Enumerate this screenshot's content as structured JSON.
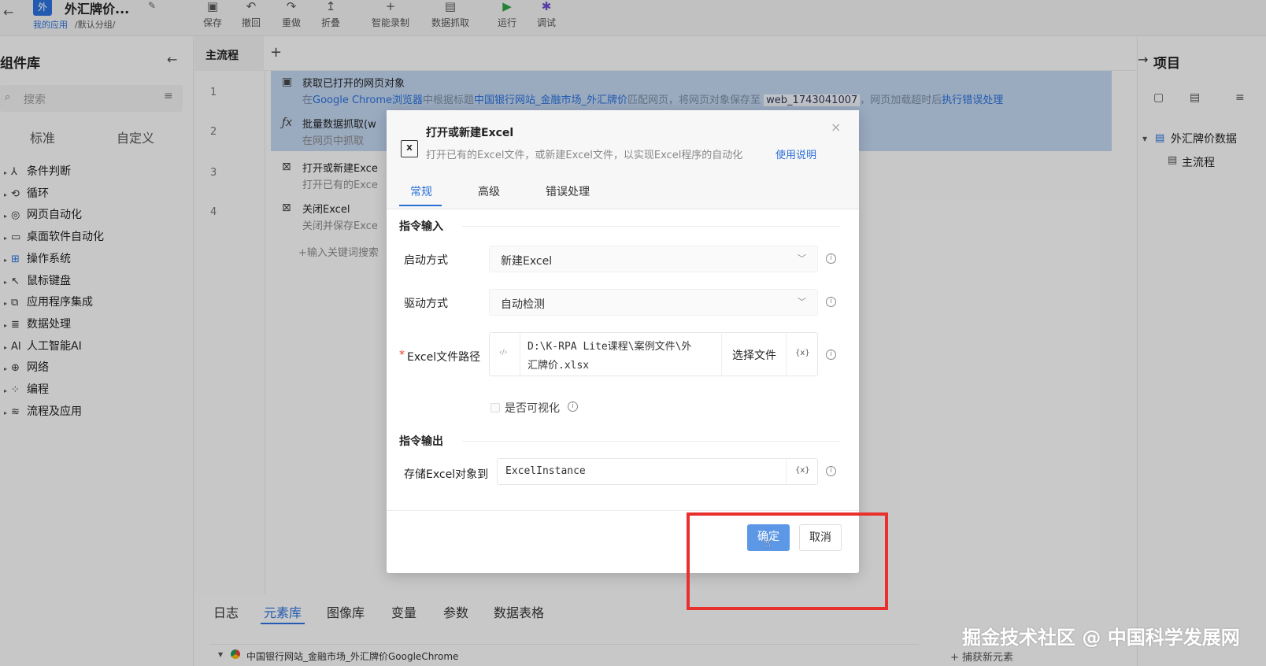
{
  "app": {
    "badge": "外",
    "title": "外汇牌价...",
    "breadcrumb_link": "我的应用",
    "breadcrumb_rest": "/默认分组/"
  },
  "toolbar": [
    {
      "label": "保存",
      "icon": "save-icon",
      "glyph": "▣"
    },
    {
      "label": "撤回",
      "icon": "undo-icon",
      "glyph": "↶"
    },
    {
      "label": "重做",
      "icon": "redo-icon",
      "glyph": "↷"
    },
    {
      "label": "折叠",
      "icon": "collapse-icon",
      "glyph": "↥"
    },
    {
      "label": "智能录制",
      "icon": "record-icon",
      "glyph": "+"
    },
    {
      "label": "数据抓取",
      "icon": "scrape-icon",
      "glyph": "▤"
    },
    {
      "label": "运行",
      "icon": "run-icon",
      "glyph": "▶"
    },
    {
      "label": "调试",
      "icon": "debug-icon",
      "glyph": "✱"
    }
  ],
  "library": {
    "title": "组件库",
    "search_placeholder": "搜索",
    "tabs": [
      "标准",
      "自定义"
    ],
    "items": [
      {
        "label": "条件判断",
        "glyph": "⅄"
      },
      {
        "label": "循环",
        "glyph": "⟲"
      },
      {
        "label": "网页自动化",
        "glyph": "◎"
      },
      {
        "label": "桌面软件自动化",
        "glyph": "▭"
      },
      {
        "label": "操作系统",
        "glyph": "⊞"
      },
      {
        "label": "鼠标键盘",
        "glyph": "↖"
      },
      {
        "label": "应用程序集成",
        "glyph": "⧉"
      },
      {
        "label": "数据处理",
        "glyph": "≣"
      },
      {
        "label": "人工智能AI",
        "glyph": "AI"
      },
      {
        "label": "网络",
        "glyph": "⊕"
      },
      {
        "label": "编程",
        "glyph": "⁘"
      },
      {
        "label": "流程及应用",
        "glyph": "≋"
      }
    ]
  },
  "flow": {
    "tab": "主流程",
    "add": "+",
    "steps": [
      {
        "num": "1",
        "title": "获取已打开的网页对象",
        "desc_pre": "在",
        "desc_link1": "Google Chrome浏览器",
        "desc_mid": "中根据标题",
        "desc_link2": "中国银行网站_金融市场_外汇牌价",
        "desc_post": "匹配网页，将网页对象保存至",
        "desc_var": "web_1743041007",
        "desc_tail": "，网页加载超时后",
        "desc_link3": "执行错误处理"
      },
      {
        "num": "2",
        "title": "批量数据抓取(w",
        "desc": "在网页中抓取"
      },
      {
        "num": "3",
        "title": "打开或新建Exce",
        "desc": "打开已有的Exce"
      },
      {
        "num": "4",
        "title": "关闭Excel",
        "desc": "关闭并保存Exce"
      }
    ],
    "add_hint": "+输入关键词搜索"
  },
  "bottom": {
    "tabs": [
      "日志",
      "元素库",
      "图像库",
      "变量",
      "参数",
      "数据表格"
    ],
    "active": "元素库",
    "element_row": "中国银行网站_金融市场_外汇牌价GoogleChrome",
    "capture": "+ 捕获新元素"
  },
  "project": {
    "title": "项目",
    "node": "外汇牌价数据",
    "child": "主流程"
  },
  "dialog": {
    "title": "打开或新建Excel",
    "subtitle": "打开已有的Excel文件，或新建Excel文件，以实现Excel程序的自动化",
    "help": "使用说明",
    "tabs": [
      "常规",
      "高级",
      "错误处理"
    ],
    "input_section": "指令输入",
    "start_label": "启动方式",
    "start_value": "新建Excel",
    "driver_label": "驱动方式",
    "driver_value": "自动检测",
    "path_required": "*",
    "path_label": "Excel文件路径",
    "path_value_line1": "D:\\K-RPA Lite课程\\案例文件\\外",
    "path_value_line2": "汇牌价.xlsx",
    "choose_file": "选择文件",
    "var_glyph": "{x}",
    "code_glyph": "‹/›",
    "visible_label": "是否可视化",
    "visible_checked": false,
    "output_section": "指令输出",
    "store_label": "存储Excel对象到",
    "store_value": "ExcelInstance",
    "ok": "确定",
    "cancel": "取消"
  },
  "watermark": "掘金技术社区 @ 中国科学发展网",
  "colors": {
    "accent": "#2a6fd6",
    "highlight_box": "#e8302c",
    "ok_button": "#5c98e6"
  }
}
